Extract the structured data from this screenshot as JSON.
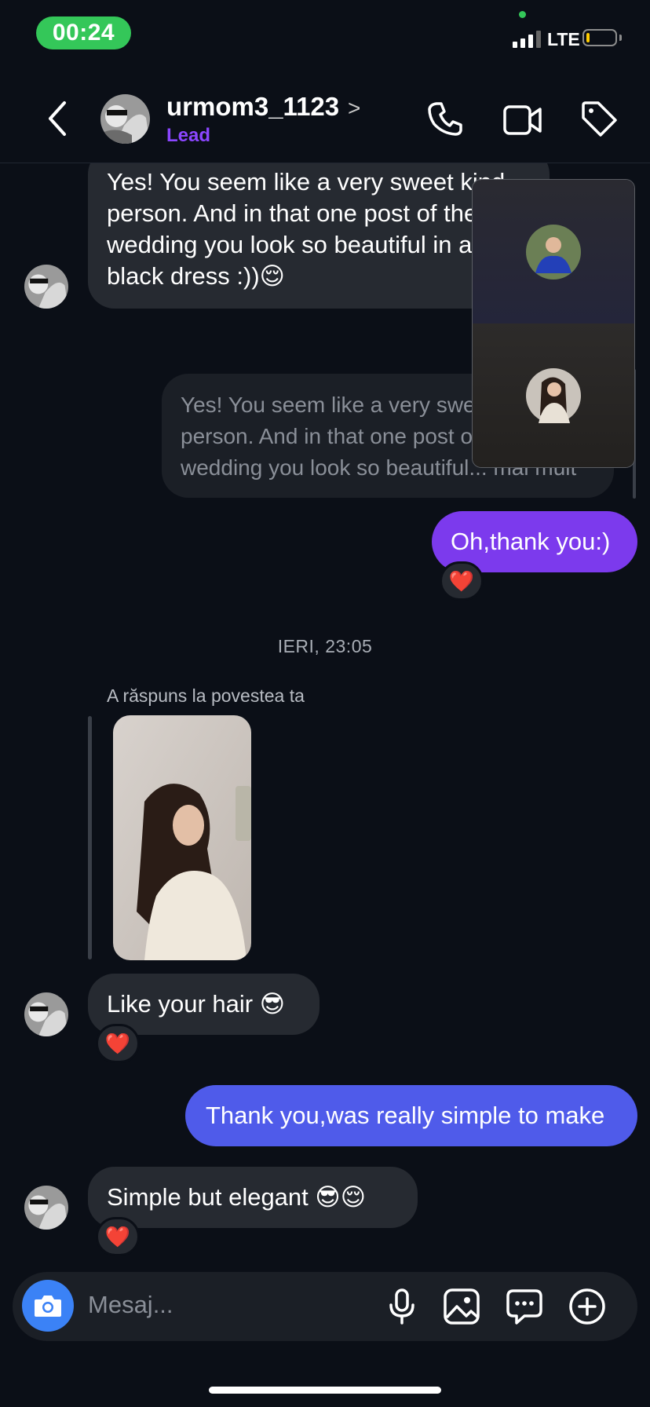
{
  "status_bar": {
    "time": "00:24",
    "network": "LTE"
  },
  "header": {
    "username": "urmom3_1123",
    "chevron": ">",
    "label": "Lead"
  },
  "messages": {
    "m1": "Yes! You seem like a very sweet kind person. And in that one post of the wedding you look so beautiful in a black dress :))😌",
    "reply_preview": "Yes! You seem like a very sweet kind person. And in that one post of the wedding you look so beautiful... mai mult",
    "m2": "Oh,thank you:)",
    "date_separator": "IERI, 23:05",
    "story_reply_label": "A răspuns la povestea ta",
    "m3": "Like your hair 😎",
    "m4": "Thank you,was really simple to make",
    "m5": "Simple but elegant 😎😌",
    "reaction": "❤️"
  },
  "composer": {
    "placeholder": "Mesaj..."
  },
  "colors": {
    "background": "#0b0f17",
    "incoming_bubble": "#262a31",
    "outgoing_purple": "#7c3aed",
    "outgoing_blue": "#4f5bea",
    "lead_label": "#8b46ff",
    "camera_button": "#3b82f6"
  },
  "icons": [
    "back-chevron-icon",
    "phone-icon",
    "video-camera-icon",
    "tag-icon",
    "camera-icon",
    "microphone-icon",
    "image-icon",
    "sticker-chat-icon",
    "plus-circle-icon"
  ]
}
